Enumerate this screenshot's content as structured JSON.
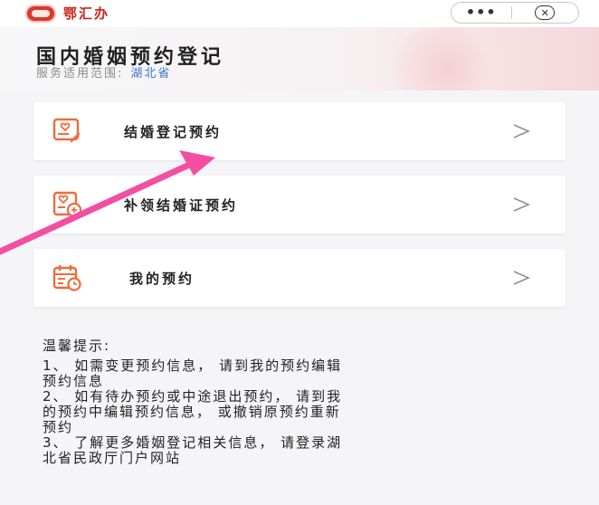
{
  "topbar": {
    "app_name": "鄂汇办",
    "more_glyph": "•••",
    "close_glyph": "✕"
  },
  "header": {
    "title": "国内婚姻预约登记",
    "scope_label": "服务适用范围:",
    "scope_value": "湖北省"
  },
  "menu": [
    {
      "label": "结婚登记预约",
      "icon": "marriage-certificate-icon"
    },
    {
      "label": "补领结婚证预约",
      "icon": "reissue-certificate-icon"
    },
    {
      "label": "我的预约",
      "icon": "calendar-clock-icon"
    }
  ],
  "tips": {
    "title": "温馨提示:",
    "items": [
      "1、 如需变更预约信息， 请到我的预约编辑\n预约信息",
      "2、 如有待办预约或中途退出预约， 请到我\n的预约中编辑预约信息， 或撤销原预约重新\n预约",
      "3、 了解更多婚姻登记相关信息， 请登录湖\n北省民政厅门户网站"
    ]
  },
  "colors": {
    "accent_orange": "#f26b3a",
    "brand_red": "#c9241b",
    "link_blue": "#3a78c9",
    "annotation_pink": "#f24fa3"
  }
}
